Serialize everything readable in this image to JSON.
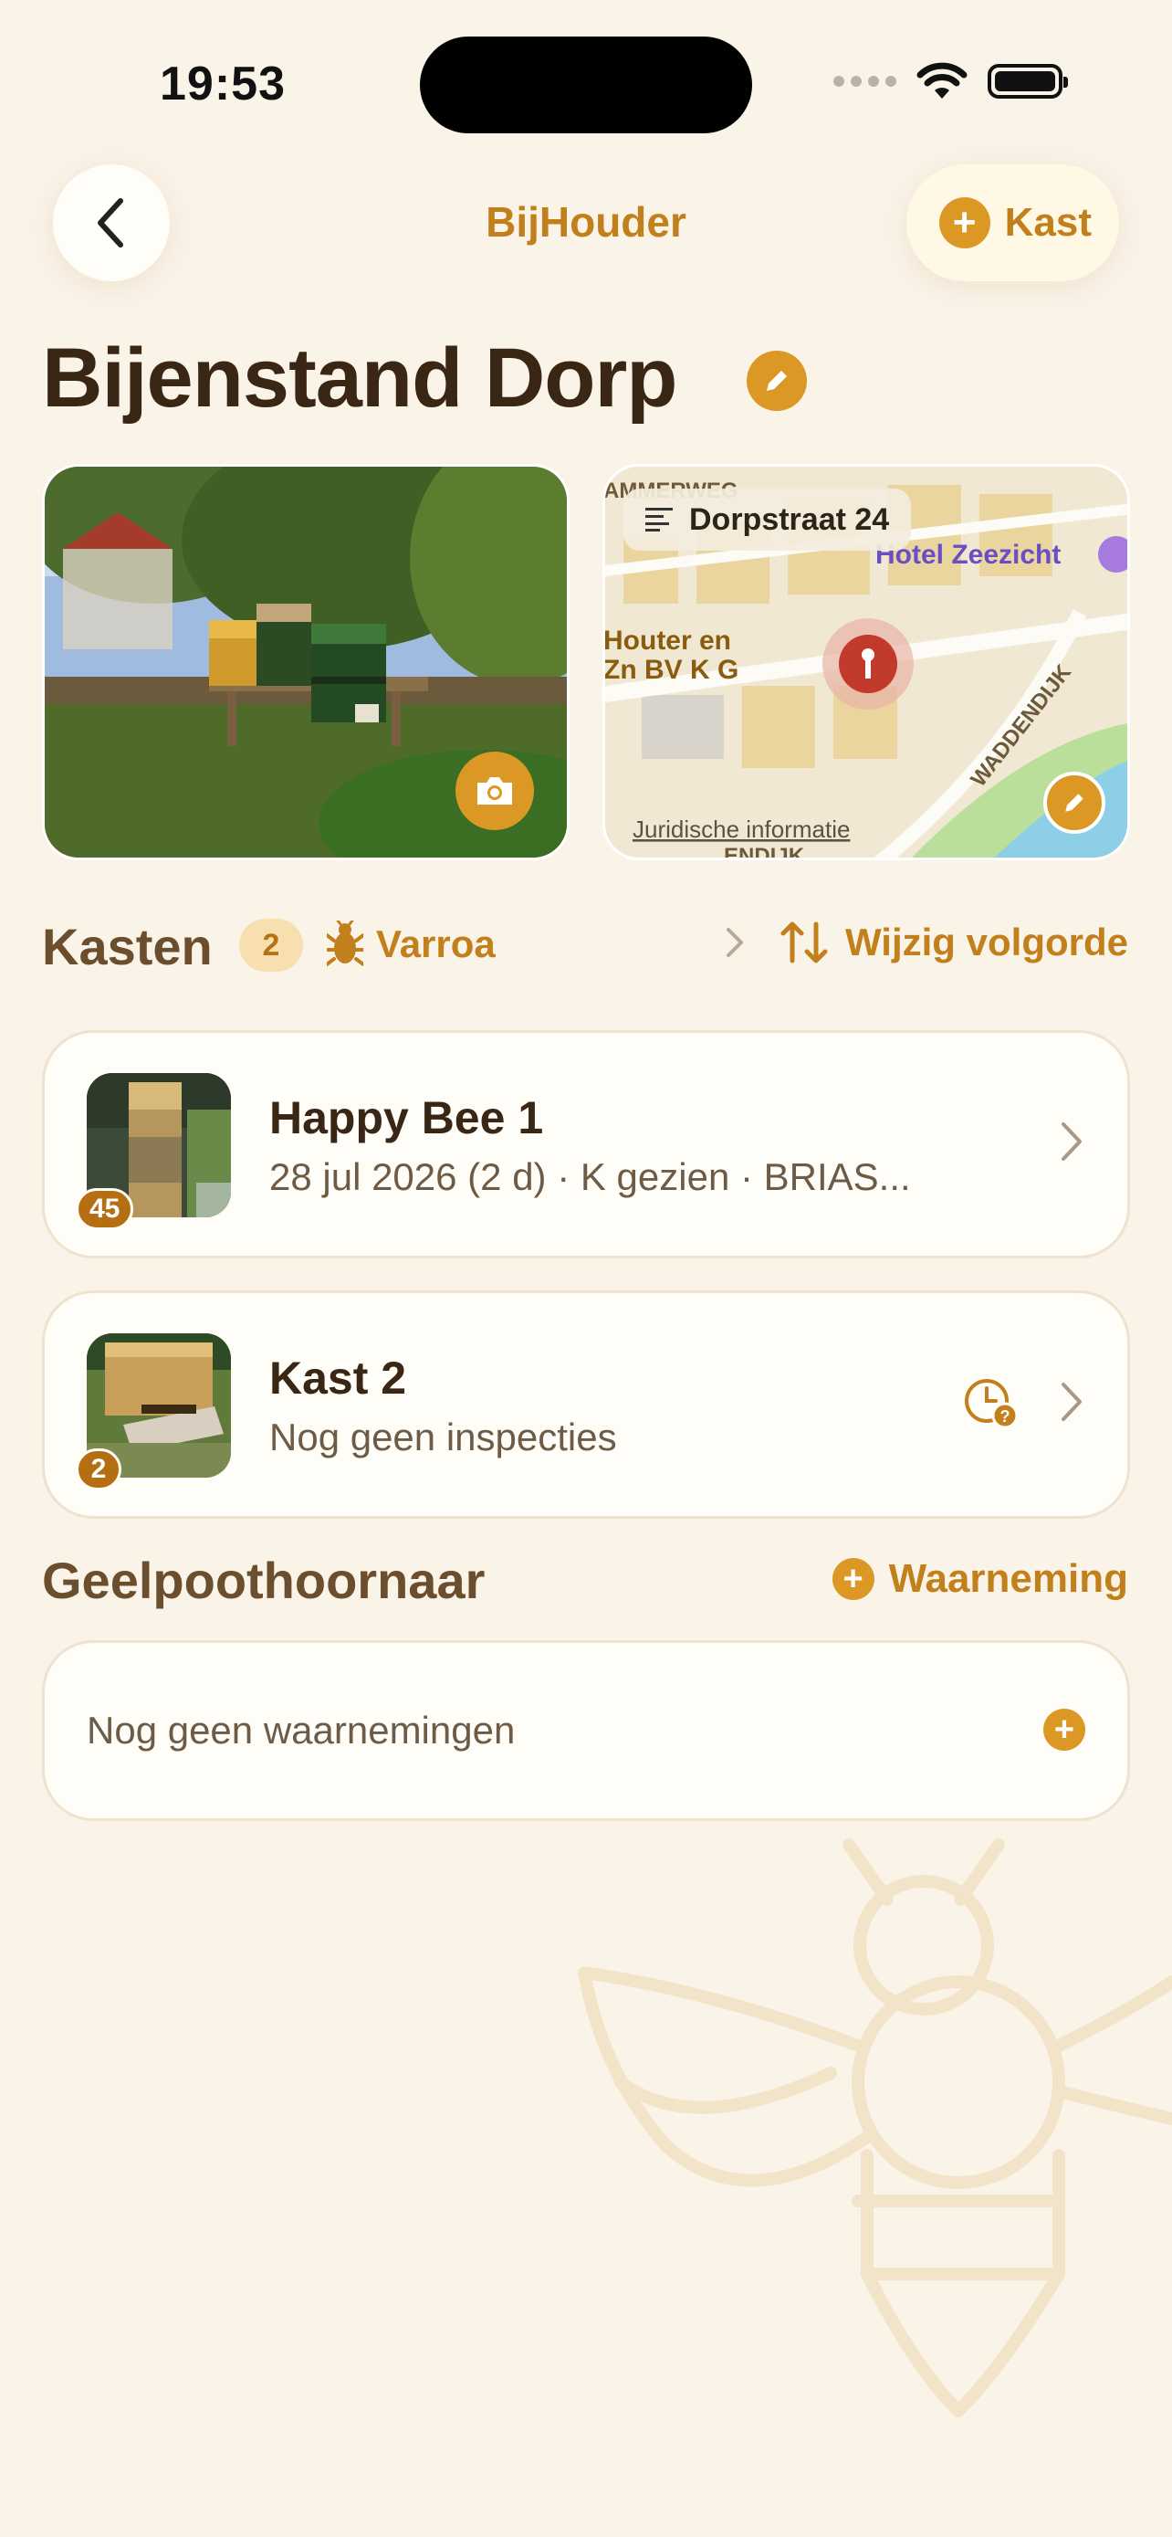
{
  "status_bar": {
    "time": "19:53"
  },
  "nav": {
    "title": "BijHouder",
    "add_kast_label": "Kast"
  },
  "page": {
    "title": "Bijenstand Dorp"
  },
  "map": {
    "address": "Dorpstraat 24",
    "legal": "Juridische informatie",
    "poi_hotel": "Hotel Zeezicht",
    "poi_shop": "Houter en\nZn BV K G",
    "street_waddendijk": "WADDENDIJK",
    "street_top": "AMMERWEG",
    "street_bottom": "ENDIJK"
  },
  "kasten": {
    "title": "Kasten",
    "count": "2",
    "varroa_label": "Varroa",
    "reorder_label": "Wijzig volgorde",
    "items": [
      {
        "name": "Happy Bee 1",
        "subtitle": "28 jul 2026 (2 d) · K gezien · BRIAS...",
        "badge": "45"
      },
      {
        "name": "Kast 2",
        "subtitle": "Nog geen inspecties",
        "badge": "2"
      }
    ]
  },
  "geelpoot": {
    "title": "Geelpoothoornaar",
    "add_label": "Waarneming",
    "empty_text": "Nog geen waarnemingen"
  },
  "colors": {
    "accent": "#dc9824",
    "accent_text": "#c1801b",
    "background": "#faf3e8",
    "card": "#fffdf7"
  }
}
